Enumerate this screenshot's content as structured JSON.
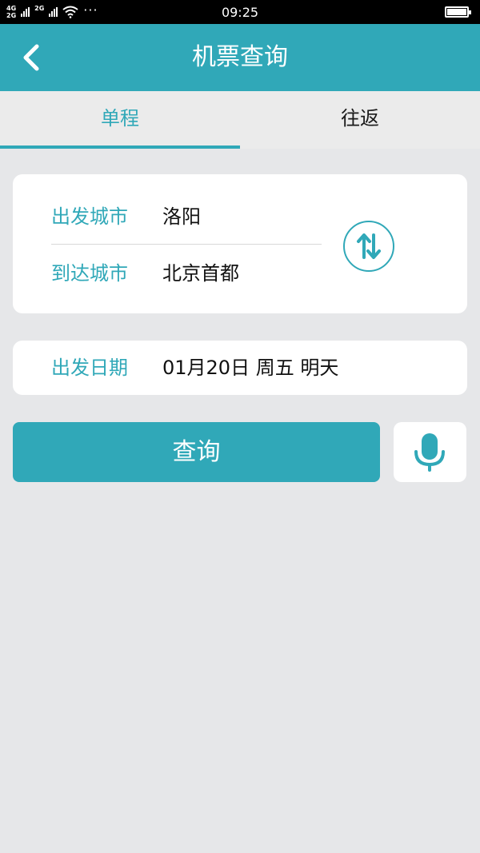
{
  "status_bar": {
    "network1": "4G",
    "network2": "2G",
    "network3": "2G",
    "time": "09:25",
    "more": "···"
  },
  "header": {
    "title": "机票查询",
    "back_icon": "chevron-left-icon"
  },
  "tabs": [
    {
      "label": "单程",
      "active": true
    },
    {
      "label": "往返",
      "active": false
    }
  ],
  "cities": {
    "departure_label": "出发城市",
    "departure_value": "洛阳",
    "arrival_label": "到达城市",
    "arrival_value": "北京首都",
    "swap_icon": "swap-vertical-icon"
  },
  "date": {
    "label": "出发日期",
    "value": "01月20日 周五 明天"
  },
  "actions": {
    "search_label": "查询",
    "mic_icon": "microphone-icon"
  },
  "colors": {
    "accent": "#30a8b8",
    "background": "#e6e7e9"
  }
}
